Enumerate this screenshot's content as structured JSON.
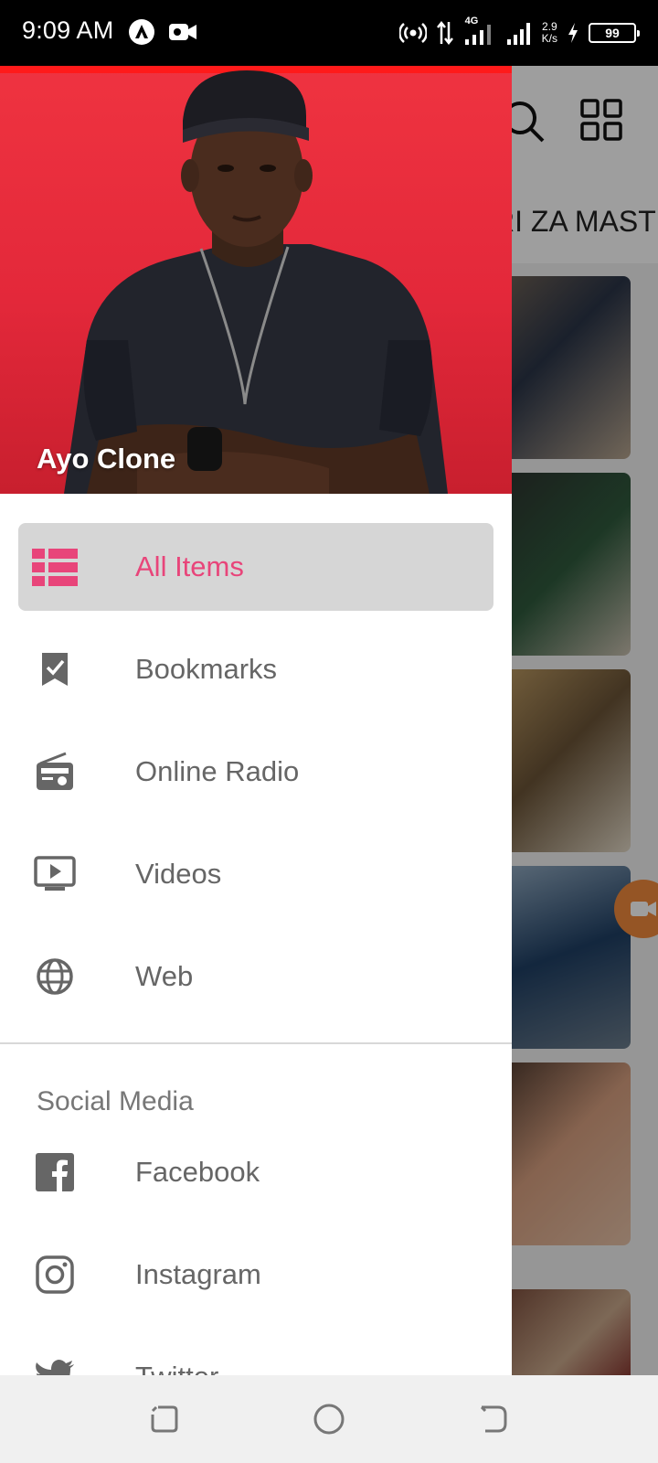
{
  "status_bar": {
    "time": "9:09 AM",
    "network_type": "4G",
    "net_speed_value": "2.9",
    "net_speed_unit": "K/s",
    "battery_level": "99"
  },
  "background": {
    "tab_text": "RI ZA MAST"
  },
  "drawer": {
    "profile_name": "Ayo Clone",
    "items": [
      {
        "label": "All Items",
        "icon": "list-icon",
        "selected": true
      },
      {
        "label": "Bookmarks",
        "icon": "bookmark-icon",
        "selected": false
      },
      {
        "label": "Online Radio",
        "icon": "radio-icon",
        "selected": false
      },
      {
        "label": "Videos",
        "icon": "video-icon",
        "selected": false
      },
      {
        "label": "Web",
        "icon": "globe-icon",
        "selected": false
      }
    ],
    "social_title": "Social Media",
    "social_items": [
      {
        "label": "Facebook",
        "icon": "facebook-icon"
      },
      {
        "label": "Instagram",
        "icon": "instagram-icon"
      },
      {
        "label": "Twitter",
        "icon": "twitter-icon"
      }
    ]
  },
  "colors": {
    "accent": "#e8457a",
    "header_red": "#e3283a",
    "selected_bg": "#d6d6d6"
  }
}
